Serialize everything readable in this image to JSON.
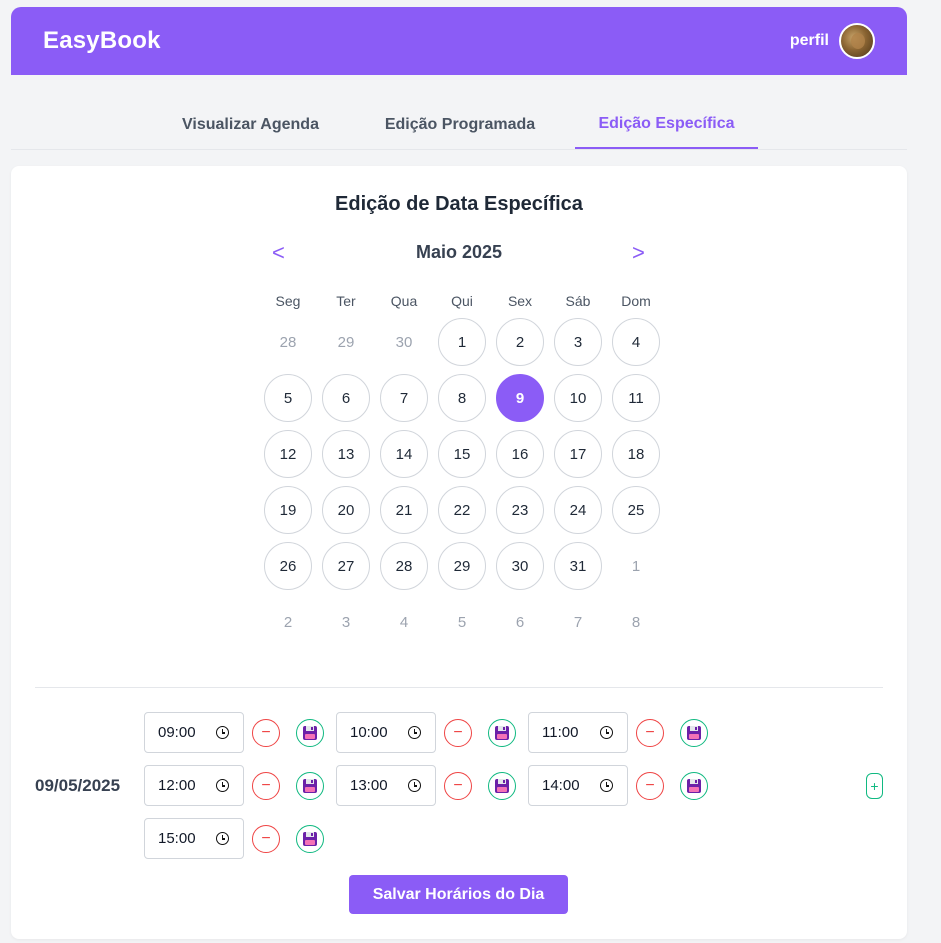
{
  "header": {
    "logo": "EasyBook",
    "profile_label": "perfil"
  },
  "tabs": [
    {
      "label": "Visualizar Agenda",
      "active": false
    },
    {
      "label": "Edição Programada",
      "active": false
    },
    {
      "label": "Edição Específica",
      "active": true
    }
  ],
  "editor": {
    "title": "Edição de Data Específica",
    "month_label": "Maio 2025",
    "prev_label": "<",
    "next_label": ">",
    "weekdays": [
      "Seg",
      "Ter",
      "Qua",
      "Qui",
      "Sex",
      "Sáb",
      "Dom"
    ],
    "weeks": [
      [
        "28",
        "29",
        "30",
        "1",
        "2",
        "3",
        "4"
      ],
      [
        "5",
        "6",
        "7",
        "8",
        "9",
        "10",
        "11"
      ],
      [
        "12",
        "13",
        "14",
        "15",
        "16",
        "17",
        "18"
      ],
      [
        "19",
        "20",
        "21",
        "22",
        "23",
        "24",
        "25"
      ],
      [
        "26",
        "27",
        "28",
        "29",
        "30",
        "31",
        "1"
      ],
      [
        "2",
        "3",
        "4",
        "5",
        "6",
        "7",
        "8"
      ]
    ],
    "selected_day": "9"
  },
  "schedule": {
    "date": "09/05/2025",
    "slots": [
      "09:00",
      "10:00",
      "11:00",
      "12:00",
      "13:00",
      "14:00",
      "15:00"
    ],
    "remove_label": "−",
    "add_label": "+",
    "save_day_label": "Salvar Horários do Dia"
  },
  "colors": {
    "accent": "#8b5cf6",
    "remove": "#ef4444",
    "save": "#10b981"
  },
  "icons": {
    "remove": "minus-circle-icon",
    "save": "floppy-disk-icon",
    "add": "plus-icon",
    "time": "clock-icon"
  }
}
